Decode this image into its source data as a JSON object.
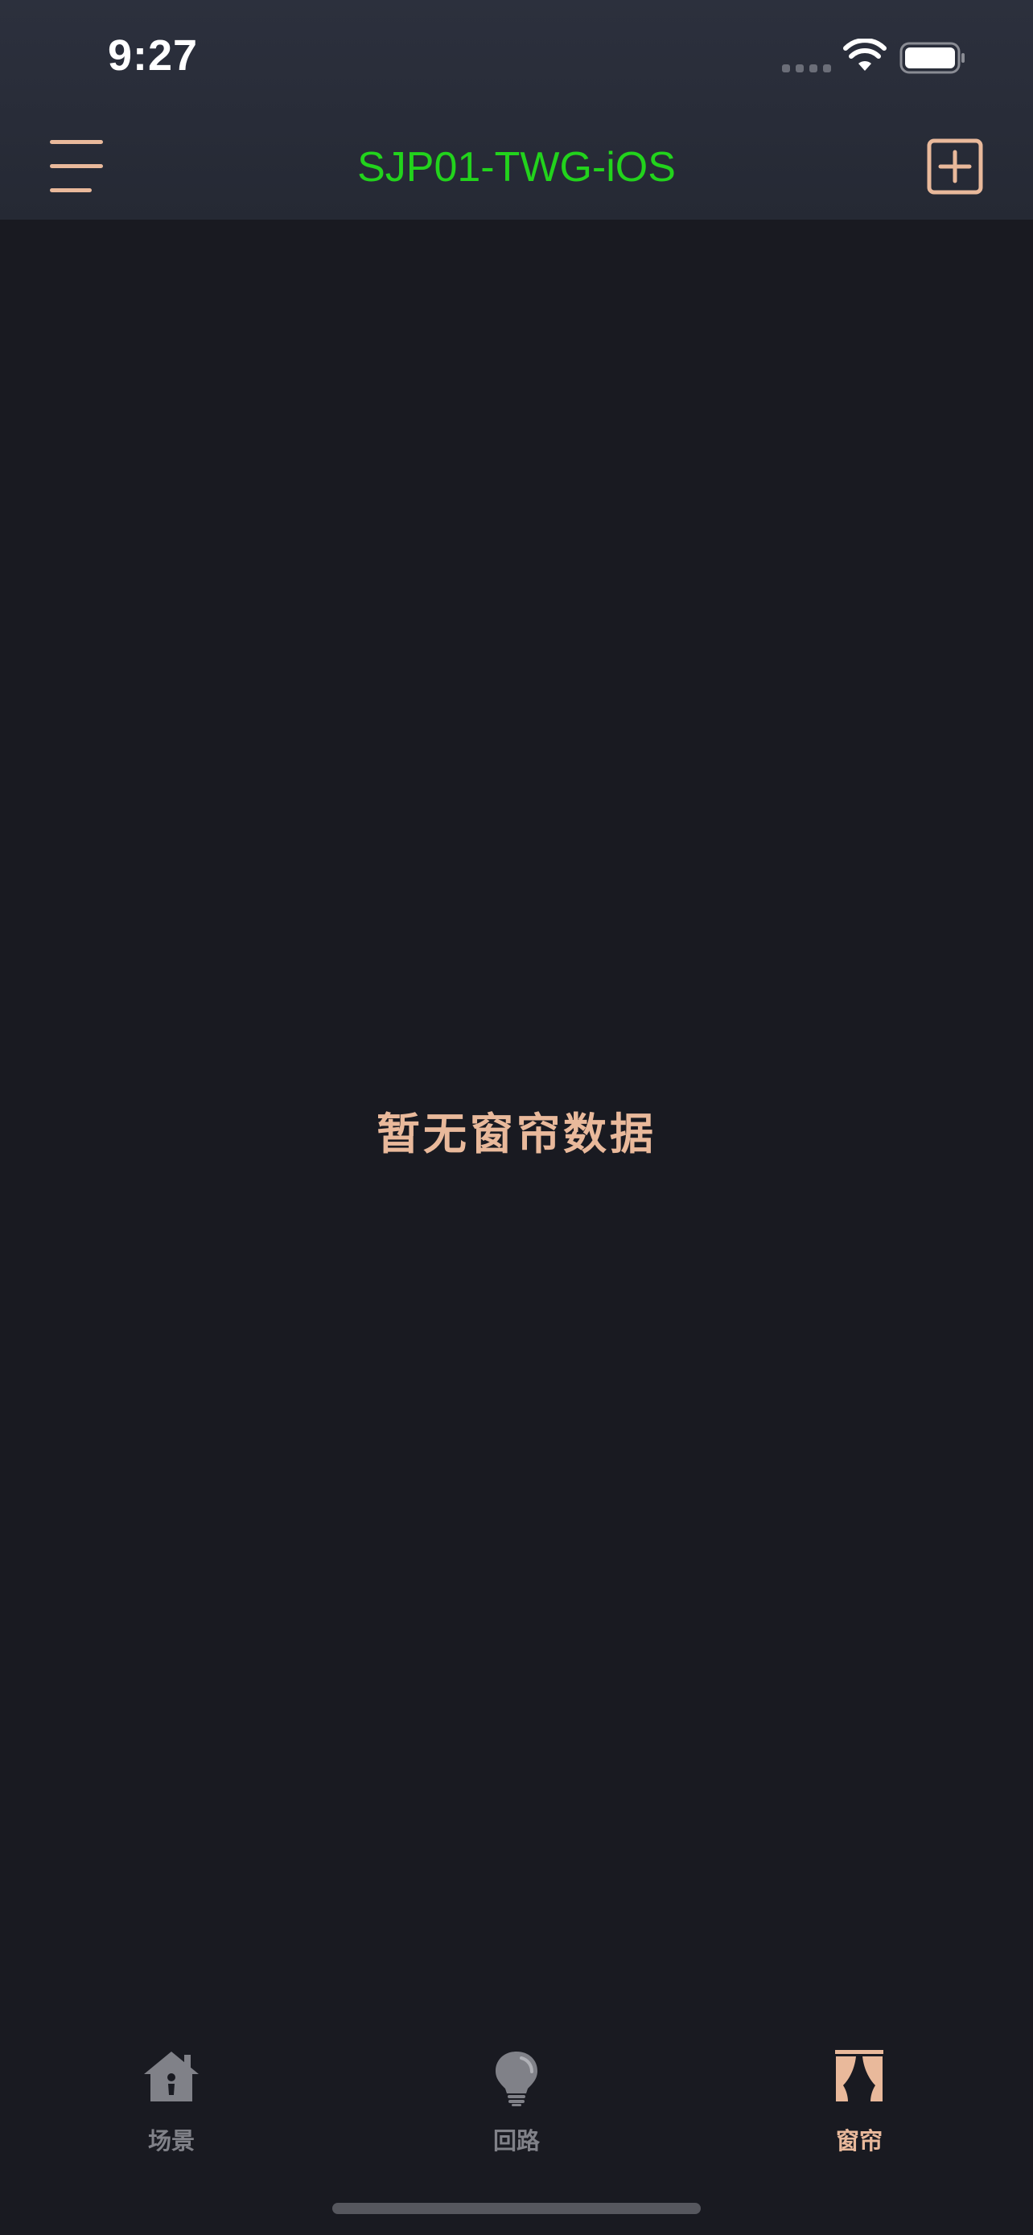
{
  "status_bar": {
    "time": "9:27"
  },
  "nav": {
    "title": "SJP01-TWG-iOS",
    "menu_icon": "hamburger-menu-icon",
    "add_icon": "plus-square-icon"
  },
  "empty_state": {
    "message": "暂无窗帘数据"
  },
  "tabs": [
    {
      "label": "场景",
      "icon": "house-icon",
      "active": false
    },
    {
      "label": "回路",
      "icon": "lightbulb-icon",
      "active": false
    },
    {
      "label": "窗帘",
      "icon": "curtain-icon",
      "active": true
    }
  ],
  "colors": {
    "background": "#191a21",
    "header": "#2a2e3a",
    "accent": "#e9b99b",
    "title_green": "#22d31c",
    "inactive": "#808188"
  }
}
